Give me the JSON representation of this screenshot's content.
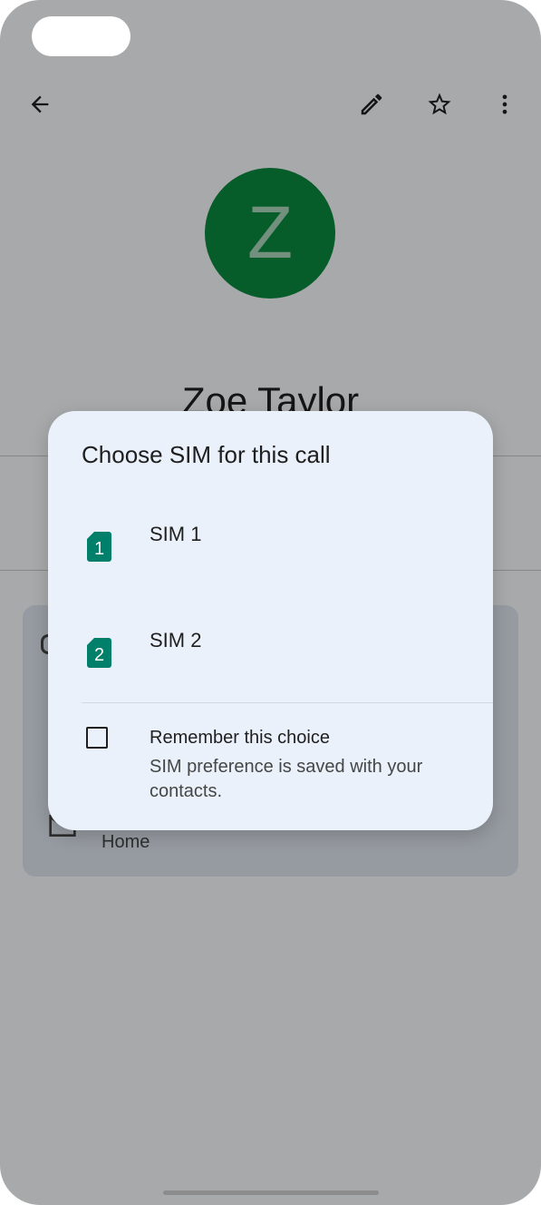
{
  "contact": {
    "avatar_letter": "Z",
    "name": "Zoe Taylor",
    "card_home_label": "Home"
  },
  "dialog": {
    "title": "Choose SIM for this call",
    "options": [
      {
        "badge": "1",
        "label": "SIM 1"
      },
      {
        "badge": "2",
        "label": "SIM 2"
      }
    ],
    "remember": {
      "title": "Remember this choice",
      "description": "SIM preference is saved with your contacts."
    }
  },
  "colors": {
    "avatar": "#0b8a3e",
    "sim_icon": "#00806a",
    "dialog_bg": "#ebf1fa"
  },
  "icons": {
    "back": "arrow-left",
    "edit": "pencil",
    "favorite": "star-outline",
    "more": "dots-vertical",
    "email": "mail-outline"
  }
}
